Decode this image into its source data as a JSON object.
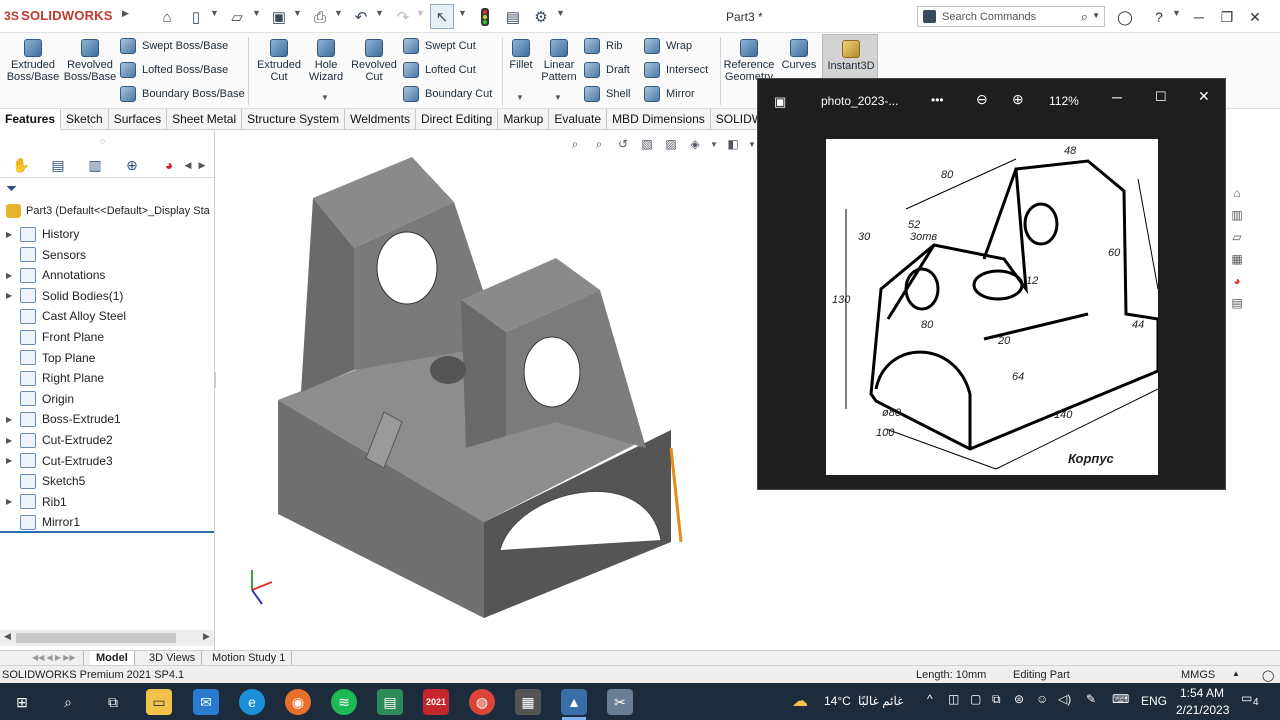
{
  "titlebar": {
    "logo": "SOLIDWORKS",
    "logo_mark": "3S",
    "document_title": "Part3 *",
    "search_placeholder": "Search Commands"
  },
  "ribbon": {
    "features": [
      {
        "id": "extruded-boss",
        "label1": "Extruded",
        "label2": "Boss/Base"
      },
      {
        "id": "revolved-boss",
        "label1": "Revolved",
        "label2": "Boss/Base"
      },
      {
        "id": "extruded-cut",
        "label1": "Extruded",
        "label2": "Cut"
      },
      {
        "id": "hole-wizard",
        "label1": "Hole",
        "label2": "Wizard"
      },
      {
        "id": "revolved-cut",
        "label1": "Revolved",
        "label2": "Cut"
      },
      {
        "id": "fillet",
        "label1": "Fillet",
        "label2": ""
      },
      {
        "id": "linear-pattern",
        "label1": "Linear",
        "label2": "Pattern"
      },
      {
        "id": "reference-geometry",
        "label1": "Reference",
        "label2": "Geometry"
      },
      {
        "id": "curves",
        "label1": "Curves",
        "label2": ""
      },
      {
        "id": "instant3d",
        "label1": "Instant3D",
        "label2": ""
      }
    ],
    "small": {
      "swept_boss": "Swept Boss/Base",
      "lofted_boss": "Lofted Boss/Base",
      "boundary_boss": "Boundary Boss/Base",
      "swept_cut": "Swept Cut",
      "lofted_cut": "Lofted Cut",
      "boundary_cut": "Boundary Cut",
      "rib": "Rib",
      "draft": "Draft",
      "shell": "Shell",
      "wrap": "Wrap",
      "intersect": "Intersect",
      "mirror": "Mirror"
    }
  },
  "tabs": [
    "Features",
    "Sketch",
    "Surfaces",
    "Sheet Metal",
    "Structure System",
    "Weldments",
    "Direct Editing",
    "Markup",
    "Evaluate",
    "MBD Dimensions",
    "SOLIDWO"
  ],
  "tree": {
    "part": "Part3  (Default<<Default>_Display Sta",
    "items": [
      {
        "label": "History",
        "expand": true
      },
      {
        "label": "Sensors",
        "expand": false
      },
      {
        "label": "Annotations",
        "expand": true
      },
      {
        "label": "Solid Bodies(1)",
        "expand": true
      },
      {
        "label": "Cast Alloy Steel",
        "expand": false
      },
      {
        "label": "Front Plane",
        "expand": false
      },
      {
        "label": "Top Plane",
        "expand": false
      },
      {
        "label": "Right Plane",
        "expand": false
      },
      {
        "label": "Origin",
        "expand": false
      },
      {
        "label": "Boss-Extrude1",
        "expand": true
      },
      {
        "label": "Cut-Extrude2",
        "expand": true
      },
      {
        "label": "Cut-Extrude3",
        "expand": true
      },
      {
        "label": "Sketch5",
        "expand": false
      },
      {
        "label": "Rib1",
        "expand": true
      },
      {
        "label": "Mirror1",
        "expand": false
      }
    ]
  },
  "viewer": {
    "filename": "photo_2023-...",
    "zoom": "112%",
    "menu": "•••"
  },
  "drawing": {
    "dims": [
      "80",
      "48",
      "52",
      "3отв",
      "30",
      "130",
      "60",
      "80",
      "12",
      "20",
      "44",
      "64",
      "140",
      "ø80",
      "100"
    ],
    "caption": "Корпус"
  },
  "bottom_tabs": [
    "Model",
    "3D Views",
    "Motion Study 1"
  ],
  "status": {
    "product": "SOLIDWORKS Premium 2021 SP4.1",
    "length": "Length: 10mm",
    "mode": "Editing Part",
    "units": "MMGS"
  },
  "taskbar": {
    "weather_temp": "14°C",
    "weather_text": "غائم غالبًا",
    "lang": "ENG",
    "time": "1:54 AM",
    "date": "2/21/2023",
    "notifications": "4",
    "sw_badge": "2021"
  },
  "colors": {
    "model_face": "#8a8a8a",
    "accent_red": "#c0392b",
    "taskbar": "#1d2c3d",
    "viewer_bg": "#1e1e1e"
  }
}
